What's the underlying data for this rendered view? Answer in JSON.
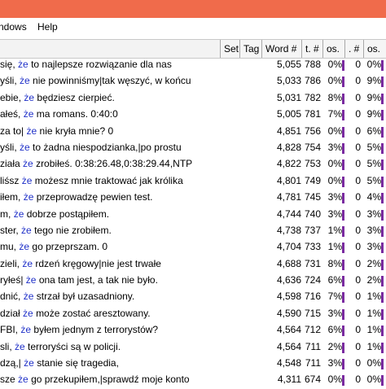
{
  "menu": {
    "windows": "ndows",
    "help": "Help"
  },
  "columns": {
    "set": "Set",
    "tag": "Tag",
    "word": "Word #",
    "t": "t. #",
    "os1": "os.",
    "dot": ". #",
    "os2": "os."
  },
  "colors": {
    "title_bar": "#f06b4b",
    "keyword": "#1e2fc8",
    "bar": "#7a2aa0"
  },
  "rows": [
    {
      "left": "się,",
      "kw": "że",
      "right": "to najlepsze rozwiązanie dla nas",
      "word": "5,055",
      "t": "788",
      "os1": "0%",
      "dot": "0",
      "os2": "0%"
    },
    {
      "left": "yśli,",
      "kw": "że",
      "right": "nie powinniśmy|tak węszyć, w końcu",
      "word": "5,033",
      "t": "786",
      "os1": "0%",
      "dot": "0",
      "os2": "9%"
    },
    {
      "left": "ebie,",
      "kw": "że",
      "right": "będziesz cierpieć.",
      "word": "5,031",
      "t": "782",
      "os1": "8%",
      "dot": "0",
      "os2": "9%"
    },
    {
      "left": "ałeś,",
      "kw": "że",
      "right": "ma romans. 0:40:0",
      "word": "5,005",
      "t": "781",
      "os1": "7%",
      "dot": "0",
      "os2": "9%"
    },
    {
      "left": "za to|",
      "kw": "że",
      "right": "nie kryła mnie? 0",
      "word": "4,851",
      "t": "756",
      "os1": "0%",
      "dot": "0",
      "os2": "6%"
    },
    {
      "left": "yśli,",
      "kw": "że",
      "right": "to żadna niespodzianka,|po prostu",
      "word": "4,828",
      "t": "754",
      "os1": "3%",
      "dot": "0",
      "os2": "5%"
    },
    {
      "left": "ziała",
      "kw": "że",
      "right": "zrobiłeś. 0:38:26.48,0:38:29.44,NTP",
      "word": "4,822",
      "t": "753",
      "os1": "0%",
      "dot": "0",
      "os2": "5%"
    },
    {
      "left": "liśsz",
      "kw": "że",
      "right": "możesz mnie traktować jak królika",
      "word": "4,801",
      "t": "749",
      "os1": "0%",
      "dot": "0",
      "os2": "5%"
    },
    {
      "left": "iłem,",
      "kw": "że",
      "right": "przeprowadzę pewien test.",
      "word": "4,781",
      "t": "745",
      "os1": "3%",
      "dot": "0",
      "os2": "4%"
    },
    {
      "left": "m,",
      "kw": "że",
      "right": "dobrze postąpiłem.",
      "word": "4,744",
      "t": "740",
      "os1": "3%",
      "dot": "0",
      "os2": "3%"
    },
    {
      "left": "ster,",
      "kw": "że",
      "right": "tego nie zrobiłem.",
      "word": "4,738",
      "t": "737",
      "os1": "1%",
      "dot": "0",
      "os2": "3%"
    },
    {
      "left": "mu,",
      "kw": "że",
      "right": "go przeprszam. 0",
      "word": "4,704",
      "t": "733",
      "os1": "1%",
      "dot": "0",
      "os2": "3%"
    },
    {
      "left": "zieli,",
      "kw": "że",
      "right": "rdzeń kręgowy|nie jest trwałe",
      "word": "4,688",
      "t": "731",
      "os1": "8%",
      "dot": "0",
      "os2": "2%"
    },
    {
      "left": "ryłeś|",
      "kw": "że",
      "right": "ona tam jest, a tak nie było.",
      "word": "4,636",
      "t": "724",
      "os1": "6%",
      "dot": "0",
      "os2": "2%"
    },
    {
      "left": "dnić,",
      "kw": "że",
      "right": "strzał był uzasadniony.",
      "word": "4,598",
      "t": "716",
      "os1": "7%",
      "dot": "0",
      "os2": "1%"
    },
    {
      "left": "dział",
      "kw": "że",
      "right": "może zostać aresztowany.",
      "word": "4,590",
      "t": "715",
      "os1": "3%",
      "dot": "0",
      "os2": "1%"
    },
    {
      "left": "FBI,",
      "kw": "że",
      "right": "byłem jednym z terrorystów?",
      "word": "4,564",
      "t": "712",
      "os1": "6%",
      "dot": "0",
      "os2": "1%"
    },
    {
      "left": "sli,",
      "kw": "że",
      "right": "terroryści są w policji.",
      "word": "4,564",
      "t": "711",
      "os1": "2%",
      "dot": "0",
      "os2": "1%"
    },
    {
      "left": "dzą,|",
      "kw": "że",
      "right": "stanie się tragedia,",
      "word": "4,548",
      "t": "711",
      "os1": "3%",
      "dot": "0",
      "os2": "0%"
    },
    {
      "left": "sze",
      "kw": "że",
      "right": "go przekupiłem,|sprawdź moje konto",
      "word": "4,311",
      "t": "674",
      "os1": "0%",
      "dot": "0",
      "os2": "0%"
    }
  ]
}
